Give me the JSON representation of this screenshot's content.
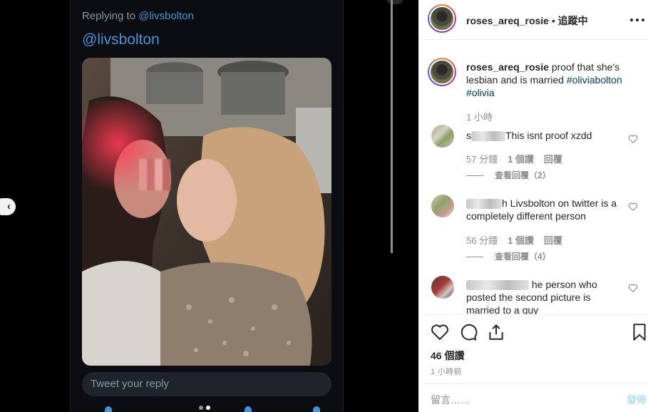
{
  "media": {
    "replying_prefix": "Replying to ",
    "replying_handle": "@livsbolton",
    "mention": "@livsbolton",
    "reply_placeholder": "Tweet your reply",
    "prev_icon": "chevron-left-icon"
  },
  "post": {
    "username": "roses_areq_rosie",
    "separator": " • ",
    "follow_status": "追蹤中",
    "caption_user": "roses_areq_rosie",
    "caption_text": " proof that she's lesbian and is married ",
    "caption_tag1": "#oliviabolton",
    "caption_tag2": "#olivia",
    "caption_time": "1 小時",
    "likes": "46 個讚",
    "post_time": "1 小時前",
    "comment_placeholder": "留言……",
    "post_button": "發佈"
  },
  "comments": [
    {
      "user_prefix": "s",
      "text": "This isnt proof xzdd",
      "time": "57 分鐘",
      "likes": "1 個讚",
      "reply": "回覆",
      "view_replies": "查看回覆（2）"
    },
    {
      "user_prefix": "",
      "text": "h Livsbolton on twitter is a completely different person",
      "time": "56 分鐘",
      "likes": "1 個讚",
      "reply": "回覆",
      "view_replies": "查看回覆（4）"
    },
    {
      "user_prefix": "",
      "text": "he person who posted the second picture is married to a guy"
    }
  ],
  "colors": {
    "link": "#00376b",
    "twitter_blue": "#4b91d6",
    "post_button": "#b2dffc"
  }
}
